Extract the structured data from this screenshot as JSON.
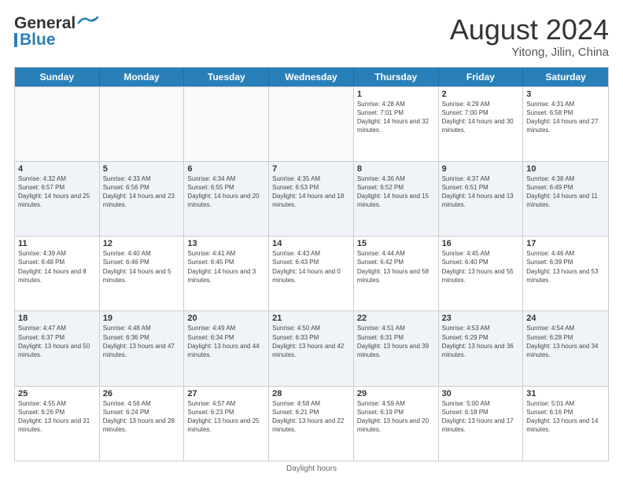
{
  "header": {
    "logo_line1": "General",
    "logo_line2": "Blue",
    "month_title": "August 2024",
    "location": "Yitong, Jilin, China"
  },
  "days_of_week": [
    "Sunday",
    "Monday",
    "Tuesday",
    "Wednesday",
    "Thursday",
    "Friday",
    "Saturday"
  ],
  "footer": {
    "daylight_label": "Daylight hours"
  },
  "weeks": [
    [
      {
        "day": "",
        "sunrise": "",
        "sunset": "",
        "daylight": "",
        "empty": true
      },
      {
        "day": "",
        "sunrise": "",
        "sunset": "",
        "daylight": "",
        "empty": true
      },
      {
        "day": "",
        "sunrise": "",
        "sunset": "",
        "daylight": "",
        "empty": true
      },
      {
        "day": "",
        "sunrise": "",
        "sunset": "",
        "daylight": "",
        "empty": true
      },
      {
        "day": "1",
        "sunrise": "Sunrise: 4:28 AM",
        "sunset": "Sunset: 7:01 PM",
        "daylight": "Daylight: 14 hours and 32 minutes.",
        "empty": false
      },
      {
        "day": "2",
        "sunrise": "Sunrise: 4:29 AM",
        "sunset": "Sunset: 7:00 PM",
        "daylight": "Daylight: 14 hours and 30 minutes.",
        "empty": false
      },
      {
        "day": "3",
        "sunrise": "Sunrise: 4:31 AM",
        "sunset": "Sunset: 6:58 PM",
        "daylight": "Daylight: 14 hours and 27 minutes.",
        "empty": false
      }
    ],
    [
      {
        "day": "4",
        "sunrise": "Sunrise: 4:32 AM",
        "sunset": "Sunset: 6:57 PM",
        "daylight": "Daylight: 14 hours and 25 minutes.",
        "empty": false
      },
      {
        "day": "5",
        "sunrise": "Sunrise: 4:33 AM",
        "sunset": "Sunset: 6:56 PM",
        "daylight": "Daylight: 14 hours and 23 minutes.",
        "empty": false
      },
      {
        "day": "6",
        "sunrise": "Sunrise: 4:34 AM",
        "sunset": "Sunset: 6:55 PM",
        "daylight": "Daylight: 14 hours and 20 minutes.",
        "empty": false
      },
      {
        "day": "7",
        "sunrise": "Sunrise: 4:35 AM",
        "sunset": "Sunset: 6:53 PM",
        "daylight": "Daylight: 14 hours and 18 minutes.",
        "empty": false
      },
      {
        "day": "8",
        "sunrise": "Sunrise: 4:36 AM",
        "sunset": "Sunset: 6:52 PM",
        "daylight": "Daylight: 14 hours and 15 minutes.",
        "empty": false
      },
      {
        "day": "9",
        "sunrise": "Sunrise: 4:37 AM",
        "sunset": "Sunset: 6:51 PM",
        "daylight": "Daylight: 14 hours and 13 minutes.",
        "empty": false
      },
      {
        "day": "10",
        "sunrise": "Sunrise: 4:38 AM",
        "sunset": "Sunset: 6:49 PM",
        "daylight": "Daylight: 14 hours and 11 minutes.",
        "empty": false
      }
    ],
    [
      {
        "day": "11",
        "sunrise": "Sunrise: 4:39 AM",
        "sunset": "Sunset: 6:48 PM",
        "daylight": "Daylight: 14 hours and 8 minutes.",
        "empty": false
      },
      {
        "day": "12",
        "sunrise": "Sunrise: 4:40 AM",
        "sunset": "Sunset: 6:46 PM",
        "daylight": "Daylight: 14 hours and 5 minutes.",
        "empty": false
      },
      {
        "day": "13",
        "sunrise": "Sunrise: 4:41 AM",
        "sunset": "Sunset: 6:45 PM",
        "daylight": "Daylight: 14 hours and 3 minutes.",
        "empty": false
      },
      {
        "day": "14",
        "sunrise": "Sunrise: 4:43 AM",
        "sunset": "Sunset: 6:43 PM",
        "daylight": "Daylight: 14 hours and 0 minutes.",
        "empty": false
      },
      {
        "day": "15",
        "sunrise": "Sunrise: 4:44 AM",
        "sunset": "Sunset: 6:42 PM",
        "daylight": "Daylight: 13 hours and 58 minutes.",
        "empty": false
      },
      {
        "day": "16",
        "sunrise": "Sunrise: 4:45 AM",
        "sunset": "Sunset: 6:40 PM",
        "daylight": "Daylight: 13 hours and 55 minutes.",
        "empty": false
      },
      {
        "day": "17",
        "sunrise": "Sunrise: 4:46 AM",
        "sunset": "Sunset: 6:39 PM",
        "daylight": "Daylight: 13 hours and 53 minutes.",
        "empty": false
      }
    ],
    [
      {
        "day": "18",
        "sunrise": "Sunrise: 4:47 AM",
        "sunset": "Sunset: 6:37 PM",
        "daylight": "Daylight: 13 hours and 50 minutes.",
        "empty": false
      },
      {
        "day": "19",
        "sunrise": "Sunrise: 4:48 AM",
        "sunset": "Sunset: 6:36 PM",
        "daylight": "Daylight: 13 hours and 47 minutes.",
        "empty": false
      },
      {
        "day": "20",
        "sunrise": "Sunrise: 4:49 AM",
        "sunset": "Sunset: 6:34 PM",
        "daylight": "Daylight: 13 hours and 44 minutes.",
        "empty": false
      },
      {
        "day": "21",
        "sunrise": "Sunrise: 4:50 AM",
        "sunset": "Sunset: 6:33 PM",
        "daylight": "Daylight: 13 hours and 42 minutes.",
        "empty": false
      },
      {
        "day": "22",
        "sunrise": "Sunrise: 4:51 AM",
        "sunset": "Sunset: 6:31 PM",
        "daylight": "Daylight: 13 hours and 39 minutes.",
        "empty": false
      },
      {
        "day": "23",
        "sunrise": "Sunrise: 4:53 AM",
        "sunset": "Sunset: 6:29 PM",
        "daylight": "Daylight: 13 hours and 36 minutes.",
        "empty": false
      },
      {
        "day": "24",
        "sunrise": "Sunrise: 4:54 AM",
        "sunset": "Sunset: 6:28 PM",
        "daylight": "Daylight: 13 hours and 34 minutes.",
        "empty": false
      }
    ],
    [
      {
        "day": "25",
        "sunrise": "Sunrise: 4:55 AM",
        "sunset": "Sunset: 6:26 PM",
        "daylight": "Daylight: 13 hours and 31 minutes.",
        "empty": false
      },
      {
        "day": "26",
        "sunrise": "Sunrise: 4:56 AM",
        "sunset": "Sunset: 6:24 PM",
        "daylight": "Daylight: 13 hours and 28 minutes.",
        "empty": false
      },
      {
        "day": "27",
        "sunrise": "Sunrise: 4:57 AM",
        "sunset": "Sunset: 6:23 PM",
        "daylight": "Daylight: 13 hours and 25 minutes.",
        "empty": false
      },
      {
        "day": "28",
        "sunrise": "Sunrise: 4:58 AM",
        "sunset": "Sunset: 6:21 PM",
        "daylight": "Daylight: 13 hours and 22 minutes.",
        "empty": false
      },
      {
        "day": "29",
        "sunrise": "Sunrise: 4:59 AM",
        "sunset": "Sunset: 6:19 PM",
        "daylight": "Daylight: 13 hours and 20 minutes.",
        "empty": false
      },
      {
        "day": "30",
        "sunrise": "Sunrise: 5:00 AM",
        "sunset": "Sunset: 6:18 PM",
        "daylight": "Daylight: 13 hours and 17 minutes.",
        "empty": false
      },
      {
        "day": "31",
        "sunrise": "Sunrise: 5:01 AM",
        "sunset": "Sunset: 6:16 PM",
        "daylight": "Daylight: 13 hours and 14 minutes.",
        "empty": false
      }
    ]
  ]
}
